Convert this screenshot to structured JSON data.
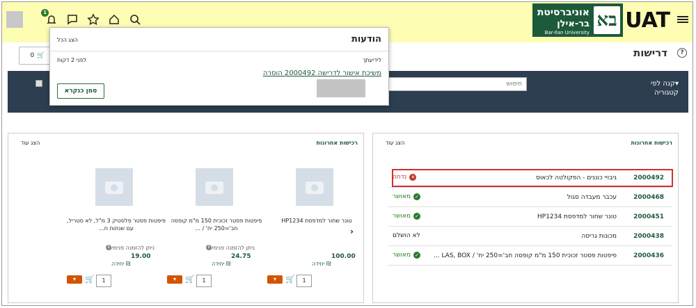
{
  "header": {
    "brand": "UAT",
    "logo_line1": "אוניברסיטת",
    "logo_line2": "בר-אילן",
    "logo_line3": "Bar-Ilan University",
    "notification_count": "1"
  },
  "page": {
    "title": "דרישות",
    "cart_count": "0"
  },
  "toolbar": {
    "category_menu": "▾קנה לפי קטגוריה",
    "search_placeholder": "חיפוש"
  },
  "notifications": {
    "title": "הודעות",
    "show_all": "הצג הכל",
    "label": "לידיעתך",
    "time": "לפני 2 דקות",
    "message": "משיכת אישור לדרישה 2000492 הוסרה",
    "mark_read": "סמן כנקרא"
  },
  "recent_orders": {
    "title": "רכישות אחרונות",
    "show_more": "הצג עוד",
    "rows": [
      {
        "id": "2000492",
        "desc": "גיבויי כוננים - הפקולטה לכאוס",
        "status": "נדחה",
        "kind": "rejected"
      },
      {
        "id": "2000468",
        "desc": "עכבר מעבדה סגול",
        "status": "מאושר",
        "kind": "ok"
      },
      {
        "id": "2000451",
        "desc": "טונר שחור למדפסת HP1234",
        "status": "מאושר",
        "kind": "ok"
      },
      {
        "id": "2000438",
        "desc": "מכונות גריסה",
        "status": "לא הושלם",
        "kind": "none"
      },
      {
        "id": "2000436",
        "desc": "פיפטות פסטר זכוכית 150 מ\"מ קופסה חב'=250 יח' / LAS, BOX ...",
        "status": "מאושר",
        "kind": "ok"
      }
    ]
  },
  "recent_purchases": {
    "title": "רכישות אחרונות",
    "show_more": "הצג עוד",
    "products": [
      {
        "name": "טונר שחור למדפסת HP1234",
        "avail": "",
        "price": "100.00",
        "unit": "₪ יחידה",
        "qty": "1"
      },
      {
        "name": "פיפטות פסטר זכוכית 150 מ\"מ קופסה חב'=250 יח' / ...",
        "avail": "ניתן להזמנה פנימית",
        "price": "24.75",
        "unit": "₪ יחידה",
        "qty": "1"
      },
      {
        "name": "פיפטות פסטר פלסטיק 3 מ\"ל, לא סטריל, עם שנתות ח...",
        "avail": "ניתן להזמנה פנימית",
        "price": "19.00",
        "unit": "₪ יחידה",
        "qty": "1"
      }
    ]
  },
  "colors": {
    "accent": "#1d5a3a",
    "topbar": "#fdfdb3",
    "darkbar": "#2c3e50",
    "highlight": "#d32f2f"
  }
}
